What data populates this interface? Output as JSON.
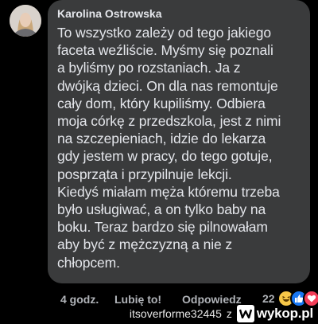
{
  "comment": {
    "author": "Karolina Ostrowska",
    "text": "To wszystko zależy od tego jakiego\nfaceta weźliście. Myśmy się poznali\na byliśmy po rozstaniach. Ja z\ndwójką dzieci. On dla nas remontuje\ncały dom, który kupiliśmy. Odbiera\nmoja córkę z przedszkola, jest z nimi\nna szczepieniach, idzie do lekarza\ngdy jestem w pracy,  do tego gotuje,\nposprząta  i przypilnuje lekcji.\nKiedyś miałam męża któremu trzeba\nbyło usługiwać, a on tylko baby na\nboku. Teraz bardzo się pilnowałam\naby być z mężczyzną a nie z\nchłopcem."
  },
  "actions": {
    "time": "4 godz.",
    "like": "Lubię to!",
    "reply": "Odpowiedz"
  },
  "reactions": {
    "count": "22",
    "icons": [
      "haha-reaction-icon",
      "like-reaction-icon",
      "love-reaction-icon"
    ]
  },
  "watermark": {
    "user": "itsoverforme32445",
    "separator": "z",
    "site": "wykop.pl"
  },
  "colors": {
    "background": "#000000",
    "bubble": "#3a3b3c",
    "text": "#e4e6eb",
    "secondary": "#b0b3b8",
    "like_blue": "#1877f2",
    "love_red": "#f33e58",
    "haha_yellow": "#f7c748"
  }
}
